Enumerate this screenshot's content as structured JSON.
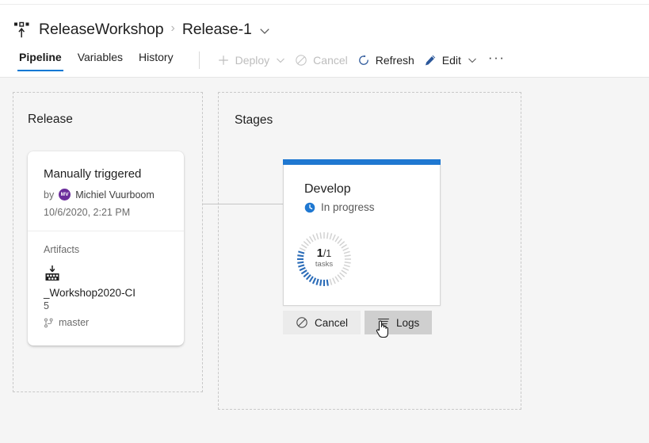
{
  "header": {
    "app_icon": "release-pipeline-icon",
    "breadcrumb": {
      "project": "ReleaseWorkshop",
      "separator": "›",
      "current": "Release-1",
      "chevron_icon": "chevron-down-icon"
    },
    "tabs": [
      {
        "label": "Pipeline",
        "active": true
      },
      {
        "label": "Variables",
        "active": false
      },
      {
        "label": "History",
        "active": false
      }
    ],
    "toolbar": [
      {
        "label": "Deploy",
        "icon": "plus-icon",
        "caret": "chevron-down-icon",
        "disabled": true
      },
      {
        "label": "Cancel",
        "icon": "cancel-circle-icon",
        "disabled": true
      },
      {
        "label": "Refresh",
        "icon": "refresh-icon",
        "disabled": false
      },
      {
        "label": "Edit",
        "icon": "pencil-icon",
        "caret": "chevron-down-icon",
        "disabled": false
      }
    ],
    "overflow_label": "···"
  },
  "canvas": {
    "release_group": {
      "title": "Release"
    },
    "stages_group": {
      "title": "Stages"
    },
    "release_card": {
      "trigger": "Manually triggered",
      "by_label": "by",
      "avatar_initials": "MV",
      "author": "Michiel Vuurboom",
      "date": "10/6/2020, 2:21 PM",
      "artifacts_label": "Artifacts",
      "artifact_icon": "build-artifact-icon",
      "artifact_name": "_Workshop2020-CI",
      "artifact_version": "5",
      "branch_icon": "branch-icon",
      "branch": "master"
    },
    "stage_card": {
      "name": "Develop",
      "status": "In progress",
      "status_icon": "in-progress-icon",
      "accent_color": "#1f78d1",
      "progress": {
        "completed": "1",
        "separator": "/",
        "total": "1",
        "label": "tasks",
        "percent": 35
      },
      "actions": [
        {
          "label": "Cancel",
          "icon": "cancel-circle-icon",
          "hovered": false
        },
        {
          "label": "Logs",
          "icon": "logs-icon",
          "hovered": true
        }
      ]
    }
  },
  "cursor": {
    "type": "pointer-hand-cursor"
  }
}
